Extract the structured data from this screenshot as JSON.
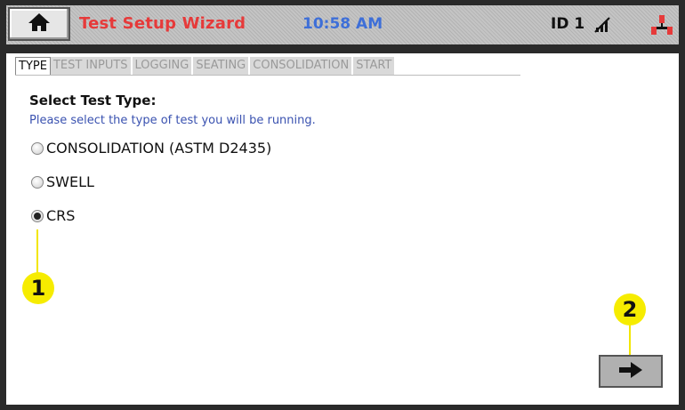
{
  "header": {
    "title": "Test Setup Wizard",
    "time": "10:58 AM",
    "device_id": "ID 1",
    "home_icon": "home-icon",
    "signal_icon": "no-signal-icon",
    "network_icon": "network-icon"
  },
  "tabs": [
    {
      "label": "TYPE",
      "active": true
    },
    {
      "label": "TEST INPUTS",
      "active": false
    },
    {
      "label": "LOGGING",
      "active": false
    },
    {
      "label": "SEATING",
      "active": false
    },
    {
      "label": "CONSOLIDATION",
      "active": false
    },
    {
      "label": "START",
      "active": false
    }
  ],
  "main": {
    "heading": "Select Test Type:",
    "instruction": "Please select the type of test you will be running.",
    "options": [
      {
        "label": "CONSOLIDATION (ASTM D2435)",
        "selected": false
      },
      {
        "label": "SWELL",
        "selected": false
      },
      {
        "label": "CRS",
        "selected": true
      }
    ]
  },
  "callouts": [
    "1",
    "2"
  ],
  "next_button": {
    "icon": "arrow-right-icon"
  },
  "colors": {
    "title": "#e63a3a",
    "clock": "#3e6fd8",
    "instruction": "#3a52b0",
    "callout": "#f6ec00"
  }
}
